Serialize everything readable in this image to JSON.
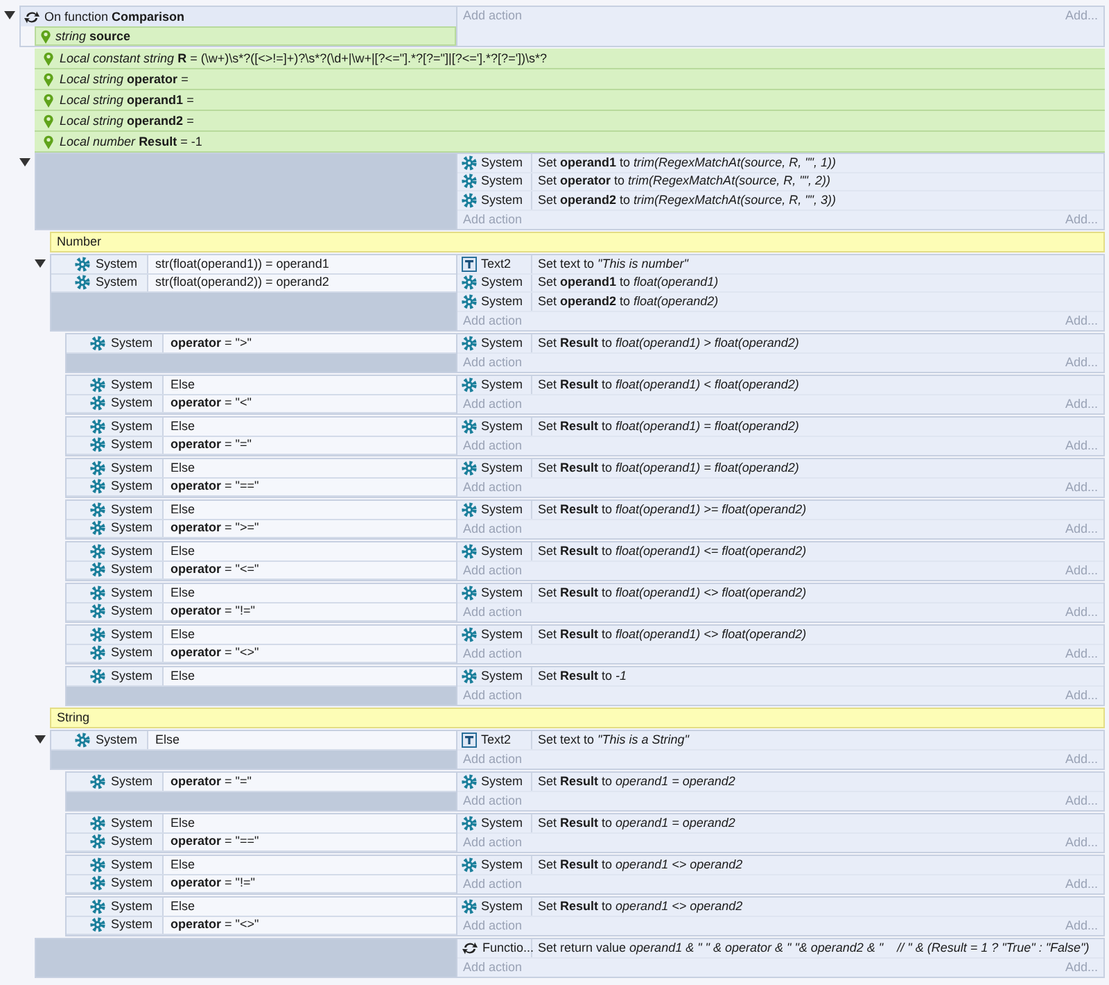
{
  "function": {
    "header": "On function **Comparison**",
    "expanded": true,
    "params": [
      "*string* **source**"
    ],
    "add_action": "Add action",
    "add_more": "Add...",
    "locals": [
      {
        "label": "Local constant string",
        "name": "R",
        "value": "= (\\w+)\\s*?([<>!=]+)?\\s*?(\\d+|\\w+|[?<=\"].*?[?=\"]|[?<='].*?[?='])\\s*?"
      },
      {
        "label": "Local string",
        "name": "operator",
        "value": "="
      },
      {
        "label": "Local string",
        "name": "operand1",
        "value": "="
      },
      {
        "label": "Local string",
        "name": "operand2",
        "value": "="
      },
      {
        "label": "Local number",
        "name": "Result",
        "value": "= -1"
      }
    ],
    "events": [
      {
        "kind": "event",
        "expanded": true,
        "actions": [
          {
            "kind": "system",
            "object": "System",
            "text": "Set **operand1** to *trim(RegexMatchAt(source, R, \"\", 1))*"
          },
          {
            "kind": "system",
            "object": "System",
            "text": "Set **operator** to *trim(RegexMatchAt(source, R, \"\", 2))*"
          },
          {
            "kind": "system",
            "object": "System",
            "text": "Set **operand2** to *trim(RegexMatchAt(source, R, \"\", 3))*"
          }
        ],
        "add_action": "Add action",
        "add_more": "Add...",
        "children": [
          {
            "kind": "comment",
            "text": "Number"
          },
          {
            "kind": "event",
            "expanded": true,
            "conditions": [
              {
                "kind": "system",
                "object": "System",
                "text": "str(float(operand1)) = operand1"
              },
              {
                "kind": "system",
                "object": "System",
                "text": "str(float(operand2)) = operand2"
              }
            ],
            "actions": [
              {
                "kind": "text",
                "object": "Text2",
                "text": "Set text to *\"This is number\"*"
              },
              {
                "kind": "system",
                "object": "System",
                "text": "Set **operand1** to *float(operand1)*"
              },
              {
                "kind": "system",
                "object": "System",
                "text": "Set **operand2** to *float(operand2)*"
              }
            ],
            "add_action": "Add action",
            "add_more": "Add...",
            "children": [
              {
                "kind": "event",
                "conditions": [
                  {
                    "kind": "system",
                    "object": "System",
                    "text": "**operator** = \">\""
                  }
                ],
                "actions": [
                  {
                    "kind": "system",
                    "object": "System",
                    "text": "Set **Result** to *float(operand1) > float(operand2)*"
                  }
                ],
                "add_action": "Add action",
                "add_more": "Add..."
              },
              {
                "kind": "event",
                "conditions": [
                  {
                    "kind": "system",
                    "object": "System",
                    "text": "Else"
                  },
                  {
                    "kind": "system",
                    "object": "System",
                    "text": "**operator** = \"<\""
                  }
                ],
                "actions": [
                  {
                    "kind": "system",
                    "object": "System",
                    "text": "Set **Result** to *float(operand1) < float(operand2)*"
                  }
                ],
                "add_action": "Add action",
                "add_more": "Add..."
              },
              {
                "kind": "event",
                "conditions": [
                  {
                    "kind": "system",
                    "object": "System",
                    "text": "Else"
                  },
                  {
                    "kind": "system",
                    "object": "System",
                    "text": "**operator** = \"=\""
                  }
                ],
                "actions": [
                  {
                    "kind": "system",
                    "object": "System",
                    "text": "Set **Result** to *float(operand1) = float(operand2)*"
                  }
                ],
                "add_action": "Add action",
                "add_more": "Add..."
              },
              {
                "kind": "event",
                "conditions": [
                  {
                    "kind": "system",
                    "object": "System",
                    "text": "Else"
                  },
                  {
                    "kind": "system",
                    "object": "System",
                    "text": "**operator** = \"==\""
                  }
                ],
                "actions": [
                  {
                    "kind": "system",
                    "object": "System",
                    "text": "Set **Result** to *float(operand1) = float(operand2)*"
                  }
                ],
                "add_action": "Add action",
                "add_more": "Add..."
              },
              {
                "kind": "event",
                "conditions": [
                  {
                    "kind": "system",
                    "object": "System",
                    "text": "Else"
                  },
                  {
                    "kind": "system",
                    "object": "System",
                    "text": "**operator** = \">=\""
                  }
                ],
                "actions": [
                  {
                    "kind": "system",
                    "object": "System",
                    "text": "Set **Result** to *float(operand1) >= float(operand2)*"
                  }
                ],
                "add_action": "Add action",
                "add_more": "Add..."
              },
              {
                "kind": "event",
                "conditions": [
                  {
                    "kind": "system",
                    "object": "System",
                    "text": "Else"
                  },
                  {
                    "kind": "system",
                    "object": "System",
                    "text": "**operator** = \"<=\""
                  }
                ],
                "actions": [
                  {
                    "kind": "system",
                    "object": "System",
                    "text": "Set **Result** to *float(operand1) <= float(operand2)*"
                  }
                ],
                "add_action": "Add action",
                "add_more": "Add..."
              },
              {
                "kind": "event",
                "conditions": [
                  {
                    "kind": "system",
                    "object": "System",
                    "text": "Else"
                  },
                  {
                    "kind": "system",
                    "object": "System",
                    "text": "**operator** = \"!=\""
                  }
                ],
                "actions": [
                  {
                    "kind": "system",
                    "object": "System",
                    "text": "Set **Result** to *float(operand1) <> float(operand2)*"
                  }
                ],
                "add_action": "Add action",
                "add_more": "Add..."
              },
              {
                "kind": "event",
                "conditions": [
                  {
                    "kind": "system",
                    "object": "System",
                    "text": "Else"
                  },
                  {
                    "kind": "system",
                    "object": "System",
                    "text": "**operator** = \"<>\""
                  }
                ],
                "actions": [
                  {
                    "kind": "system",
                    "object": "System",
                    "text": "Set **Result** to *float(operand1) <> float(operand2)*"
                  }
                ],
                "add_action": "Add action",
                "add_more": "Add..."
              },
              {
                "kind": "event",
                "conditions": [
                  {
                    "kind": "system",
                    "object": "System",
                    "text": "Else"
                  }
                ],
                "actions": [
                  {
                    "kind": "system",
                    "object": "System",
                    "text": "Set **Result** to *-1*"
                  }
                ],
                "add_action": "Add action",
                "add_more": "Add..."
              }
            ]
          },
          {
            "kind": "comment",
            "text": "String"
          },
          {
            "kind": "event",
            "expanded": true,
            "conditions": [
              {
                "kind": "system",
                "object": "System",
                "text": "Else"
              }
            ],
            "actions": [
              {
                "kind": "text",
                "object": "Text2",
                "text": "Set text to *\"This is a String\"*"
              }
            ],
            "add_action": "Add action",
            "add_more": "Add...",
            "children": [
              {
                "kind": "event",
                "conditions": [
                  {
                    "kind": "system",
                    "object": "System",
                    "text": "**operator** = \"=\""
                  }
                ],
                "actions": [
                  {
                    "kind": "system",
                    "object": "System",
                    "text": "Set **Result** to *operand1 = operand2*"
                  }
                ],
                "add_action": "Add action",
                "add_more": "Add..."
              },
              {
                "kind": "event",
                "conditions": [
                  {
                    "kind": "system",
                    "object": "System",
                    "text": "Else"
                  },
                  {
                    "kind": "system",
                    "object": "System",
                    "text": "**operator** = \"==\""
                  }
                ],
                "actions": [
                  {
                    "kind": "system",
                    "object": "System",
                    "text": "Set **Result** to *operand1 = operand2*"
                  }
                ],
                "add_action": "Add action",
                "add_more": "Add..."
              },
              {
                "kind": "event",
                "conditions": [
                  {
                    "kind": "system",
                    "object": "System",
                    "text": "Else"
                  },
                  {
                    "kind": "system",
                    "object": "System",
                    "text": "**operator** = \"!=\""
                  }
                ],
                "actions": [
                  {
                    "kind": "system",
                    "object": "System",
                    "text": "Set **Result** to *operand1 <> operand2*"
                  }
                ],
                "add_action": "Add action",
                "add_more": "Add..."
              },
              {
                "kind": "event",
                "conditions": [
                  {
                    "kind": "system",
                    "object": "System",
                    "text": "Else"
                  },
                  {
                    "kind": "system",
                    "object": "System",
                    "text": "**operator** = \"<>\""
                  }
                ],
                "actions": [
                  {
                    "kind": "system",
                    "object": "System",
                    "text": "Set **Result** to *operand1 <> operand2*"
                  }
                ],
                "add_action": "Add action",
                "add_more": "Add..."
              }
            ]
          }
        ]
      },
      {
        "kind": "event",
        "actions": [
          {
            "kind": "function",
            "object": "Functio...",
            "text": "Set return value *operand1 & \" \" & operator & \" \"& operand2 & \"    // \" & (Result = 1 ? \"True\" : \"False\")*"
          }
        ],
        "add_action": "Add action",
        "add_more": "Add..."
      }
    ]
  }
}
